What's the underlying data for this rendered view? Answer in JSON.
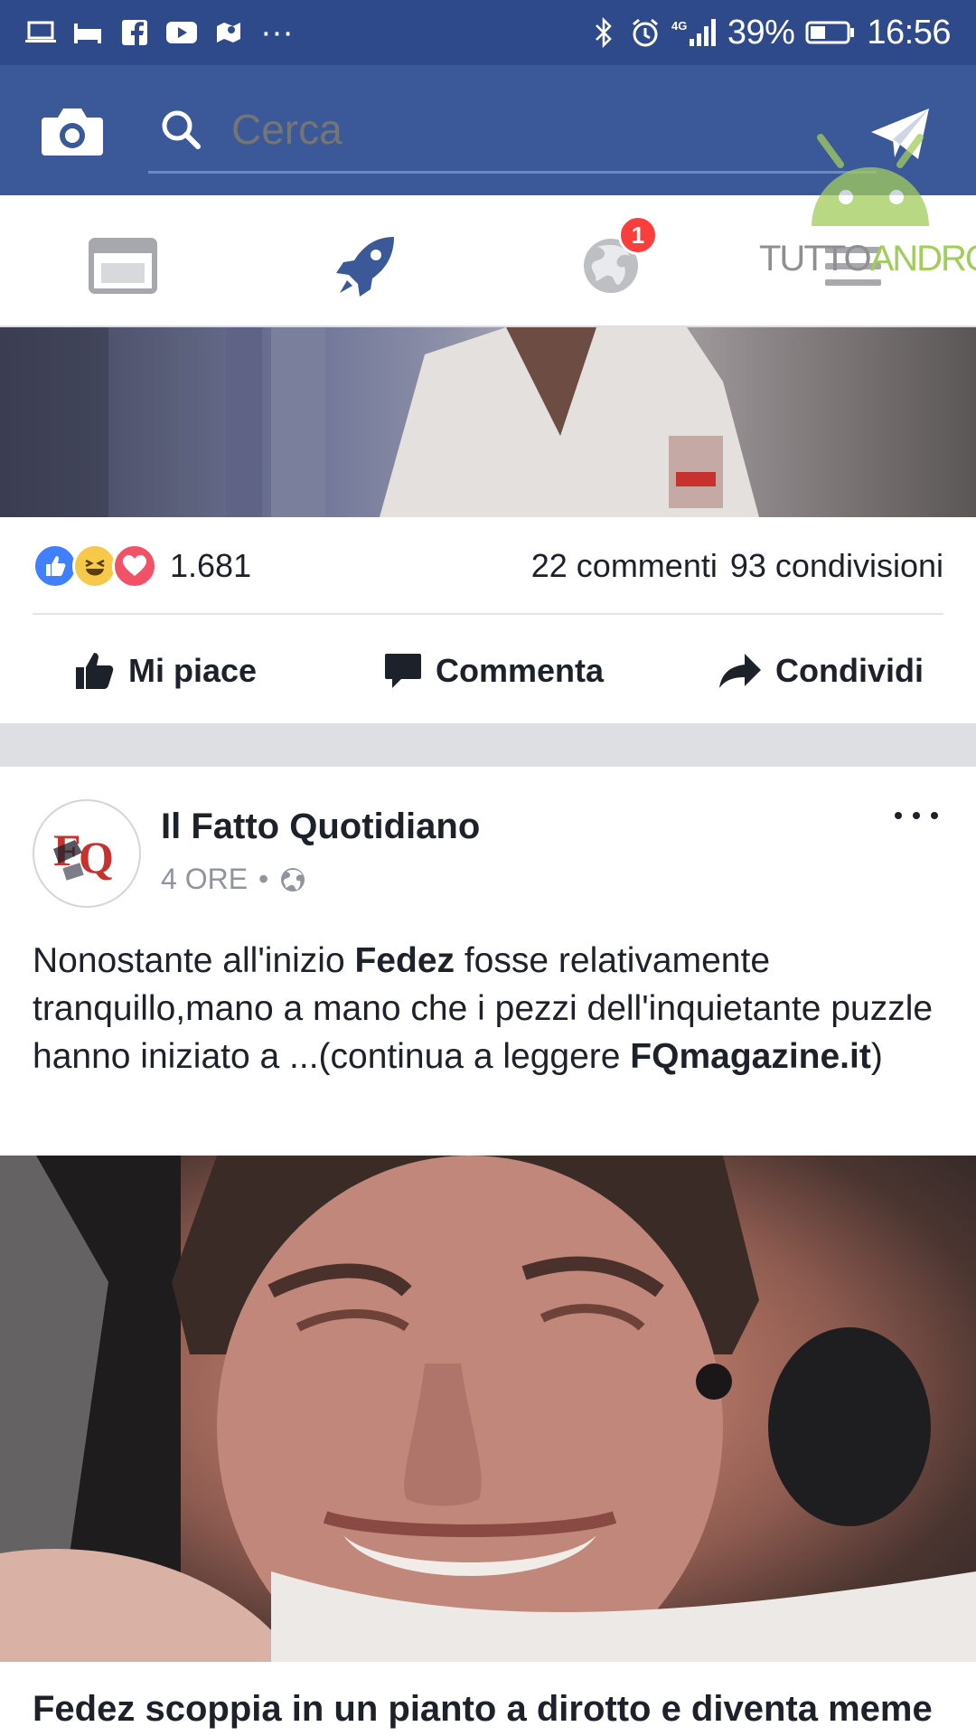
{
  "status_bar": {
    "battery_percent": "39%",
    "time": "16:56",
    "network": "4G",
    "more": "···"
  },
  "header": {
    "search_placeholder": "Cerca"
  },
  "tabs": [
    {
      "name": "news-feed",
      "badge": ""
    },
    {
      "name": "explore",
      "badge": ""
    },
    {
      "name": "notifications",
      "badge": "1"
    },
    {
      "name": "menu",
      "badge": ""
    }
  ],
  "watermark": {
    "part1": "TUTTO",
    "part2": "ANDROID"
  },
  "previous_post": {
    "reactions_count": "1.681",
    "comments": "22 commenti",
    "shares": "93 condivisioni",
    "actions": {
      "like": "Mi piace",
      "comment": "Commenta",
      "share": "Condividi"
    }
  },
  "post": {
    "author": "Il Fatto Quotidiano",
    "time": "4 ORE",
    "separator": "•",
    "text_1": "Nonostante all'inizio ",
    "text_bold_1": "Fedez",
    "text_2": " fosse relativamente tranquillo,mano a mano che i pezzi dell'inquietante puzzle hanno iniziato a ...(continua a leggere ",
    "text_bold_2": "FQmagazine.it",
    "text_3": ")",
    "headline": "Fedez scoppia in un pianto a dirotto e diventa meme"
  },
  "colors": {
    "status_bar": "#2f4a8b",
    "header": "#3b5998",
    "active_tab": "#3b5998",
    "badge": "#fa3e3e",
    "like": "#4080ff",
    "love": "#f25268",
    "haha": "#f7c94b"
  }
}
